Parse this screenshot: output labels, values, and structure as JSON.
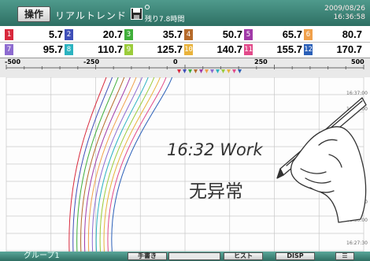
{
  "header": {
    "operate_label": "操作",
    "mode_label": "リアルトレンド",
    "remaining_label": "残り7.8時間",
    "date": "2009/08/26",
    "time": "16:36:58"
  },
  "channels": [
    {
      "num": "1",
      "value": "5.7",
      "color": "#d8283c"
    },
    {
      "num": "2",
      "value": "20.7",
      "color": "#3f4fb8"
    },
    {
      "num": "3",
      "value": "35.7",
      "color": "#3fae3a"
    },
    {
      "num": "4",
      "value": "50.7",
      "color": "#b56a2a"
    },
    {
      "num": "5",
      "value": "65.7",
      "color": "#a13aa8"
    },
    {
      "num": "6",
      "value": "80.7",
      "color": "#f0a04a"
    },
    {
      "num": "7",
      "value": "95.7",
      "color": "#8d6bd0"
    },
    {
      "num": "8",
      "value": "110.7",
      "color": "#2bb3c0"
    },
    {
      "num": "9",
      "value": "125.7",
      "color": "#9bcc3a"
    },
    {
      "num": "10",
      "value": "140.7",
      "color": "#e9b23a"
    },
    {
      "num": "11",
      "value": "155.7",
      "color": "#e24a8a"
    },
    {
      "num": "12",
      "value": "170.7",
      "color": "#2a5fb8"
    }
  ],
  "scale": {
    "ticks": [
      "-500",
      "-250",
      "0",
      "250",
      "500"
    ]
  },
  "time_labels": [
    "16:37:00",
    "16:35:00",
    "16:32:30",
    "16:30:00",
    "16:27:30"
  ],
  "annotation": {
    "line1": "16:32 Work",
    "line2": "无异常"
  },
  "footer": {
    "group_label": "グループ1",
    "handwrite_button": "手書き",
    "hist_button": "ヒスト",
    "disp_button": "DISP"
  }
}
